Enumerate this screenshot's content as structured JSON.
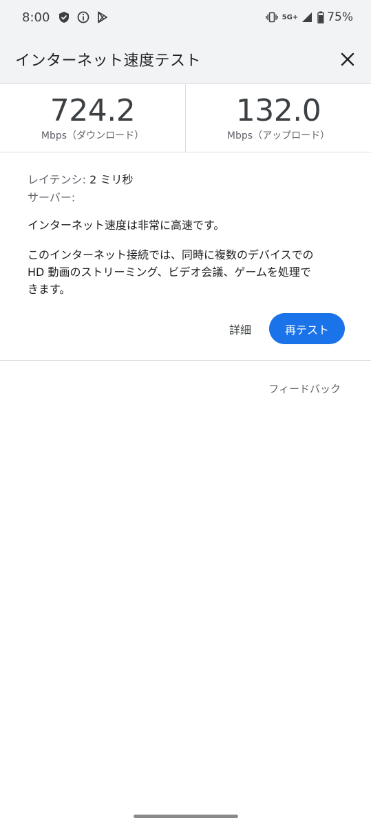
{
  "status_bar": {
    "time": "8:00",
    "network": "5G+",
    "battery": "75%",
    "icons": [
      "shield-icon",
      "info-icon",
      "play-store-icon",
      "vibrate-icon",
      "signal-icon",
      "battery-icon"
    ]
  },
  "header": {
    "title": "インターネット速度テスト",
    "close_icon": "close-icon"
  },
  "results": {
    "download": {
      "value": "724.2",
      "unit": "Mbps（ダウンロード）"
    },
    "upload": {
      "value": "132.0",
      "unit": "Mbps（アップロード）"
    }
  },
  "details": {
    "latency_label": "レイテンシ:",
    "latency_value": "2 ミリ秒",
    "server_label": "サーバー:",
    "summary": "インターネット速度は非常に高速です。",
    "description_line1": "このインターネット接続では、同時に複数のデバイスでの",
    "description_line2": "HD 動画のストリーミング、ビデオ会議、ゲームを処理で",
    "description_line3": "きます。"
  },
  "actions": {
    "details_label": "詳細",
    "retest_label": "再テスト"
  },
  "feedback_label": "フィードバック",
  "colors": {
    "accent": "#1a73e8",
    "header_bg": "#f1f3f4",
    "divider": "#dadce0"
  }
}
